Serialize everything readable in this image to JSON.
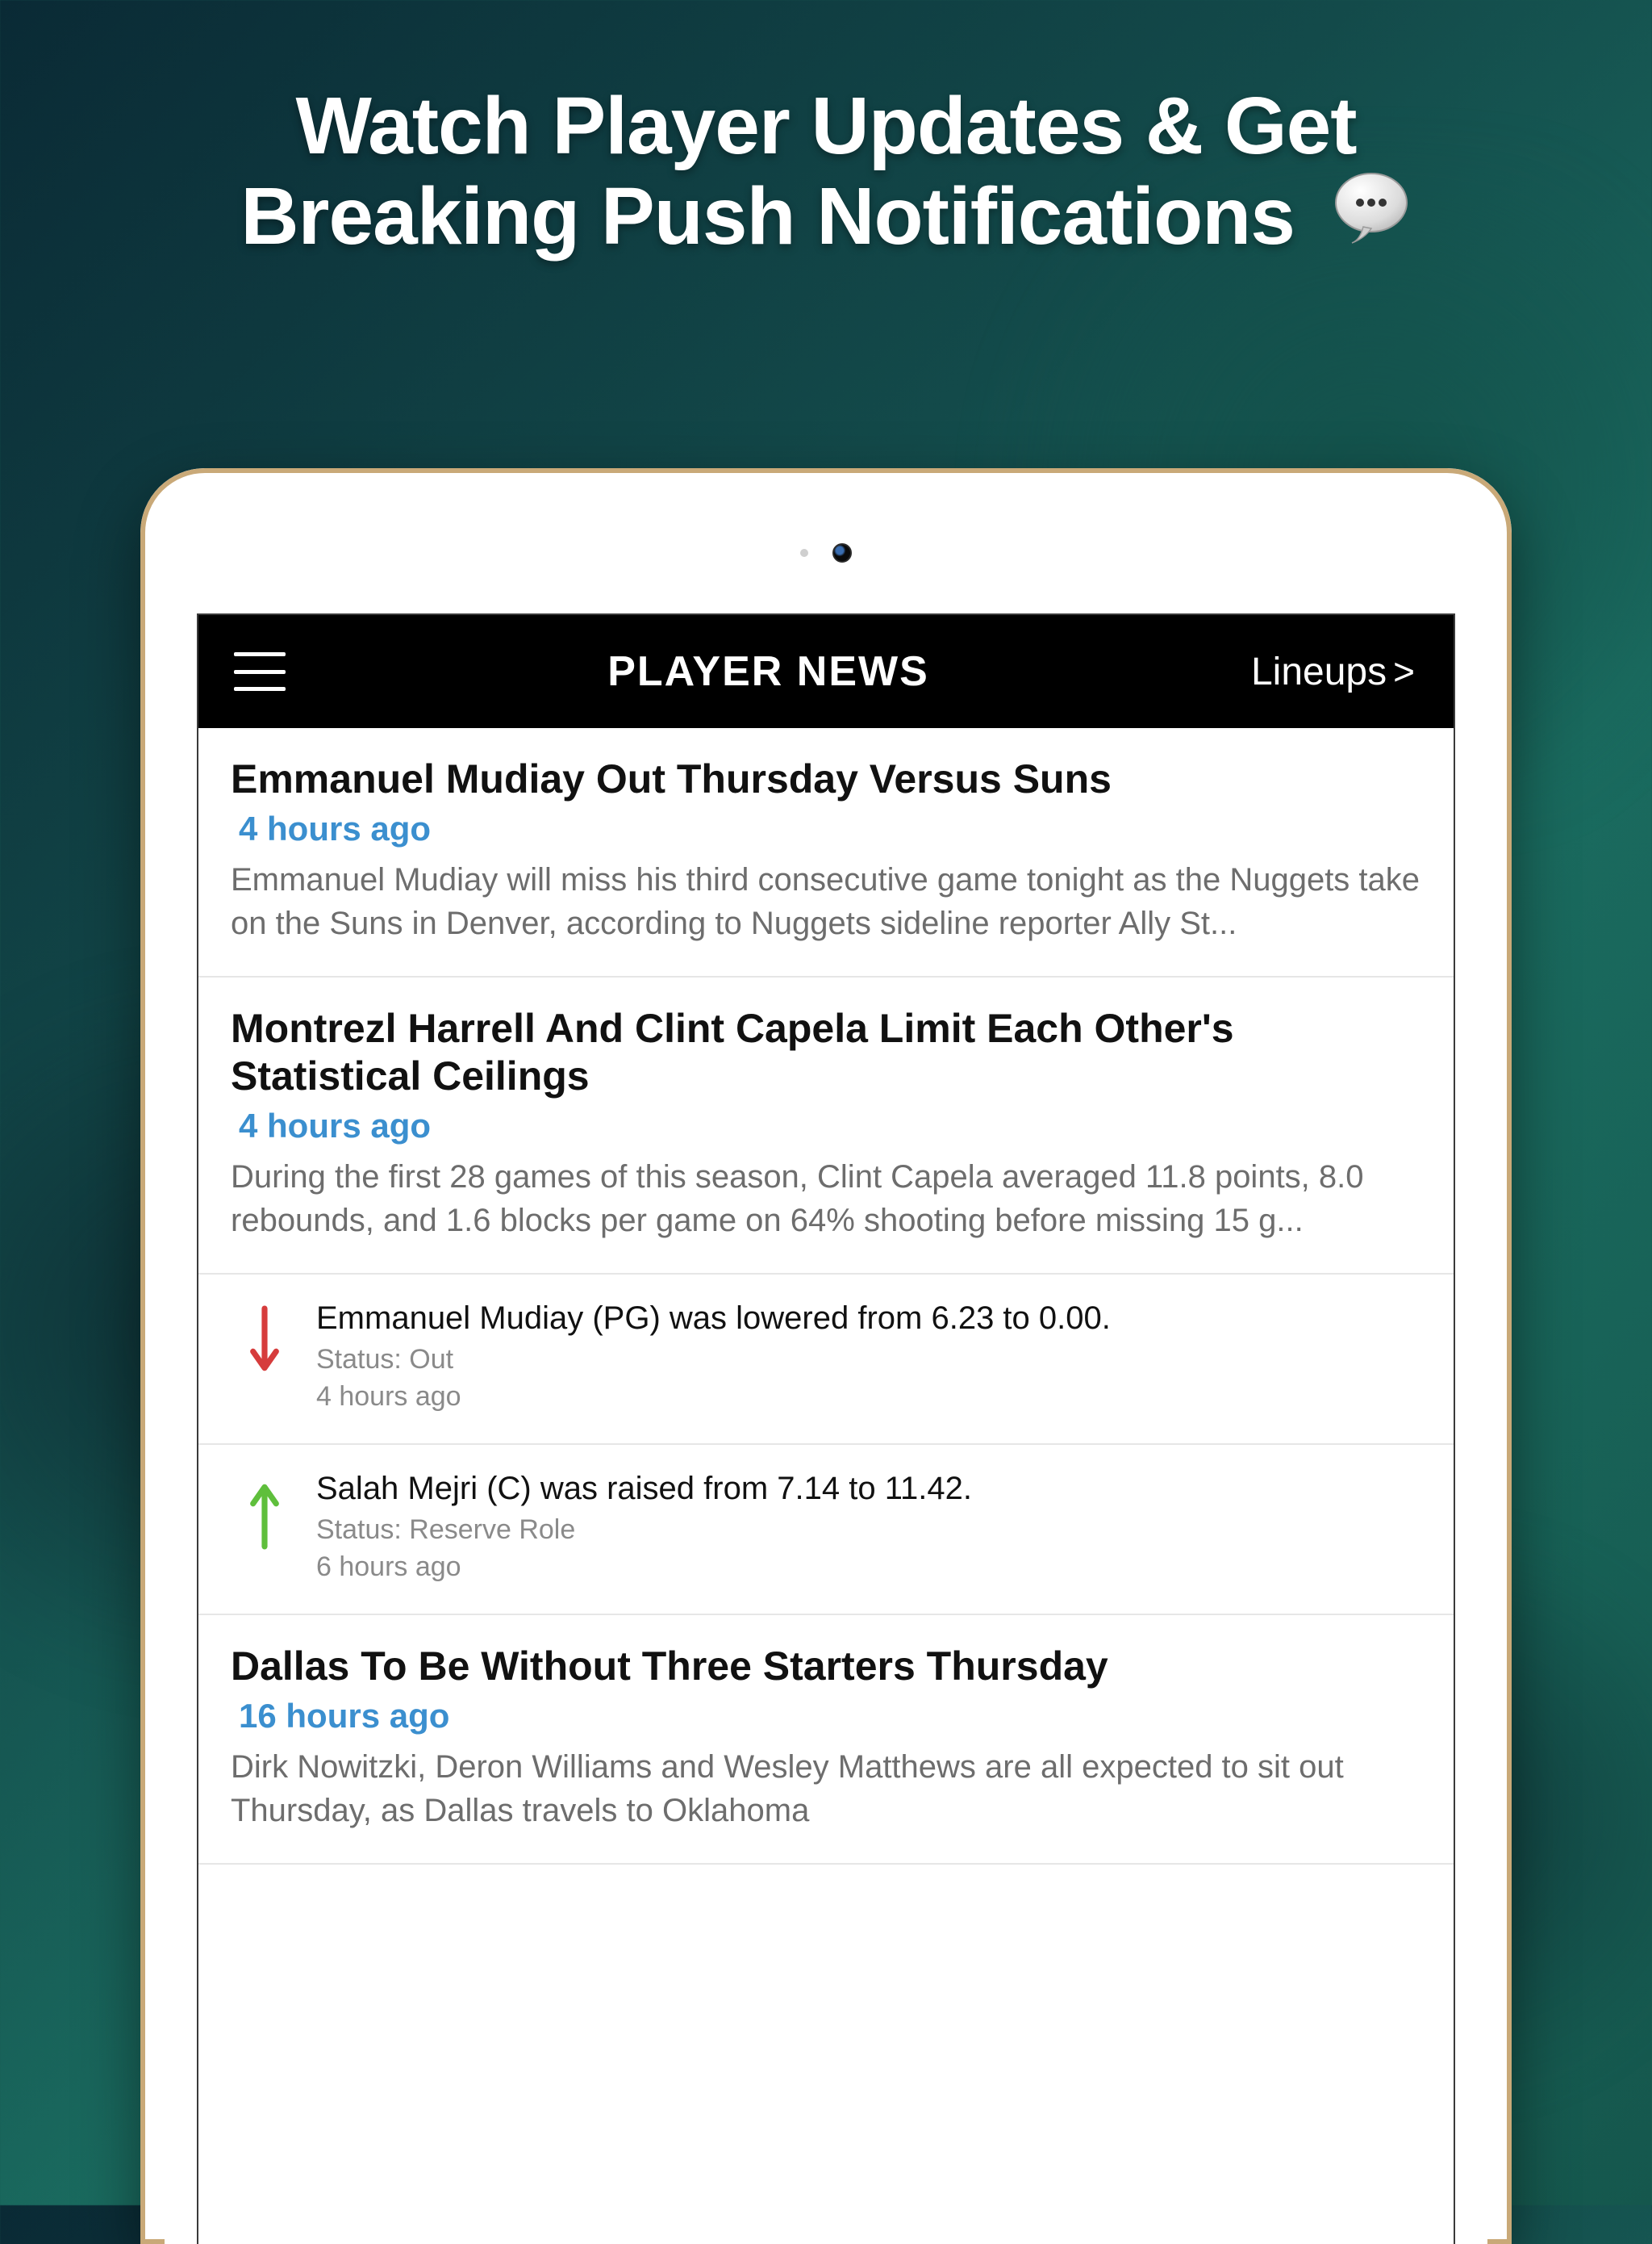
{
  "promo": {
    "headline_line1": "Watch Player Updates & Get",
    "headline_line2": "Breaking Push Notifications"
  },
  "navbar": {
    "title": "PLAYER NEWS",
    "right_label": "Lineups",
    "right_glyph": ">"
  },
  "feed": [
    {
      "kind": "article",
      "title": "Emmanuel Mudiay Out Thursday Versus Suns",
      "time": "4 hours ago",
      "excerpt": "Emmanuel Mudiay will miss his third consecutive game tonight as the Nuggets take on the Suns in Denver, according to Nuggets sideline reporter Ally St..."
    },
    {
      "kind": "article",
      "title": "Montrezl Harrell And Clint Capela Limit Each Other's Statistical Ceilings",
      "time": "4 hours ago",
      "excerpt": "During the first 28 games of this season, Clint Capela averaged 11.8 points, 8.0 rebounds, and 1.6 blocks per game on 64% shooting before missing 15 g..."
    },
    {
      "kind": "update",
      "direction": "down",
      "line1": "Emmanuel Mudiay (PG) was lowered from 6.23 to 0.00.",
      "status": "Status: Out",
      "ago": "4 hours ago"
    },
    {
      "kind": "update",
      "direction": "up",
      "line1": "Salah Mejri (C) was raised from 7.14 to 11.42.",
      "status": "Status: Reserve Role",
      "ago": "6 hours ago"
    },
    {
      "kind": "article",
      "title": "Dallas To Be Without Three Starters Thursday",
      "time": "16 hours ago",
      "excerpt": "Dirk Nowitzki, Deron Williams and Wesley Matthews are all expected to sit out Thursday, as Dallas travels to Oklahoma"
    }
  ],
  "colors": {
    "arrow_down": "#d63c3c",
    "arrow_up": "#5fbf3c",
    "link_blue": "#3b8fcf"
  }
}
